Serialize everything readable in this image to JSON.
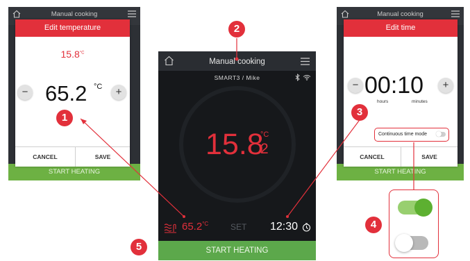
{
  "colors": {
    "accent_red": "#e2303b",
    "start_green": "#5ca84b",
    "toggle_on_green": "#5db031",
    "screen_dark": "#16181b"
  },
  "left_dialog": {
    "header_title": "Manual cooking",
    "dialog_title": "Edit temperature",
    "current_temp": "15.8",
    "current_temp_unit": "°C",
    "decrease_label": "−",
    "target_value": "65.2",
    "target_unit": "°C",
    "increase_label": "+",
    "cancel_label": "CANCEL",
    "save_label": "SAVE",
    "start_label": "START HEATING"
  },
  "center_screen": {
    "header_title": "Manual cooking",
    "home_label": "Home",
    "program_user": "SMART3 / Mike",
    "core_temp_int": "15.8",
    "core_temp_unit": "°C",
    "core_temp_decimal": "2",
    "set_temp": "65.2",
    "set_temp_unit": "°C",
    "set_label": "SET",
    "timer": "12:30",
    "start_label": "START HEATING"
  },
  "right_dialog": {
    "header_title": "Manual cooking",
    "dialog_title": "Edit time",
    "decrease_label": "−",
    "time_value": "00:10",
    "increase_label": "+",
    "hours_label": "hours",
    "minutes_label": "minutes",
    "continuous_label": "Continuous time mode",
    "cancel_label": "CANCEL",
    "save_label": "SAVE",
    "start_label": "START HEATING"
  },
  "toggle_states": {
    "on": true,
    "off": false
  },
  "callouts": [
    "1",
    "2",
    "3",
    "4",
    "5"
  ]
}
